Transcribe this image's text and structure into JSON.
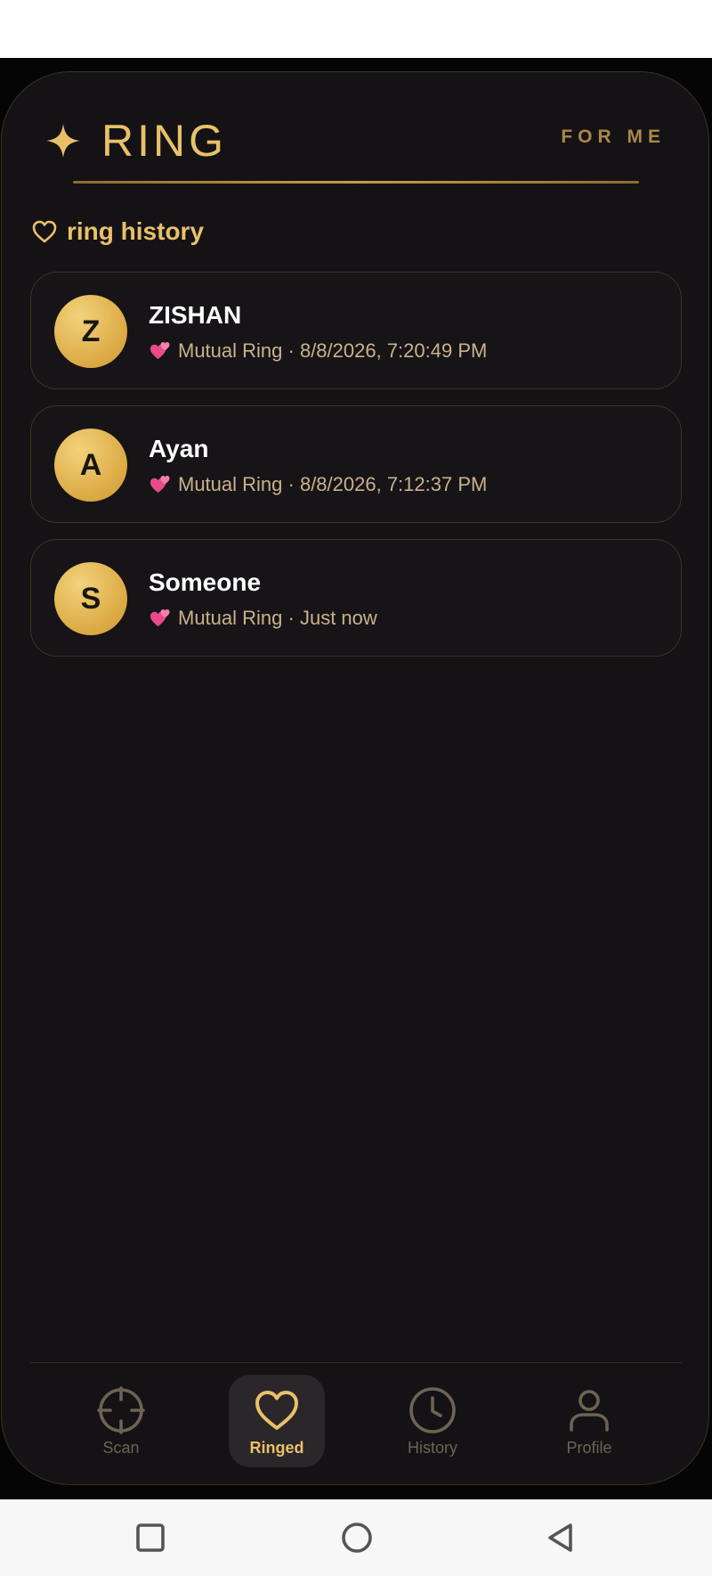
{
  "header": {
    "title": "RING",
    "right_label": "FOR ME",
    "icon": "sparkle-icon",
    "accent_color": "#e9c06a"
  },
  "section": {
    "title": "ring history",
    "icon": "heart-outline-icon"
  },
  "rings": [
    {
      "initial": "Z",
      "name": "ZISHAN",
      "type": "Mutual Ring",
      "time": "8/8/2026, 7:20:49 PM"
    },
    {
      "initial": "A",
      "name": "Ayan",
      "type": "Mutual Ring",
      "time": "8/8/2026, 7:12:37 PM"
    },
    {
      "initial": "S",
      "name": "Someone",
      "type": "Mutual Ring",
      "time": "Just now"
    }
  ],
  "nav": {
    "items": [
      {
        "label": "Scan",
        "icon": "crosshair-icon",
        "active": false
      },
      {
        "label": "Ringed",
        "icon": "heart-icon",
        "active": true
      },
      {
        "label": "History",
        "icon": "clock-icon",
        "active": false
      },
      {
        "label": "Profile",
        "icon": "user-icon",
        "active": false
      }
    ]
  },
  "system_nav": {
    "recents_icon": "square-icon",
    "home_icon": "circle-icon",
    "back_icon": "triangle-back-icon"
  }
}
